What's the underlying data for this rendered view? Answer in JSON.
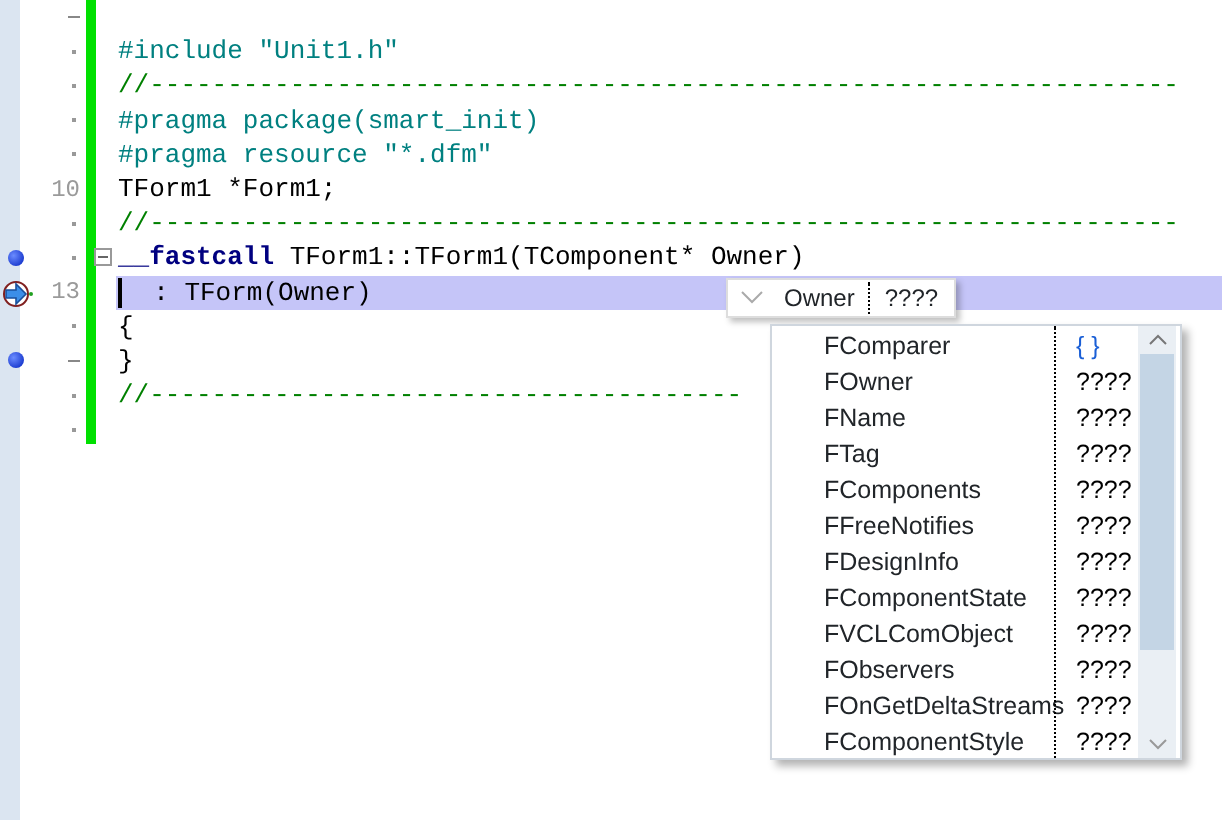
{
  "editor": {
    "lines": [
      {
        "kind": "dash"
      },
      {
        "kind": "dot",
        "segments": [
          {
            "kind": "directive",
            "text": "#include \"Unit1.h\""
          }
        ]
      },
      {
        "kind": "dot",
        "segments": [
          {
            "kind": "comment",
            "text": "//------------------------------------------------------------------"
          }
        ]
      },
      {
        "kind": "dot",
        "segments": [
          {
            "kind": "directive",
            "text": "#pragma package(smart_init)"
          }
        ]
      },
      {
        "kind": "dot",
        "segments": [
          {
            "kind": "directive",
            "text": "#pragma resource \"*.dfm\""
          }
        ]
      },
      {
        "kind": "number",
        "number": "10",
        "segments": [
          {
            "kind": "plain",
            "text": "TForm1 *Form1;"
          }
        ]
      },
      {
        "kind": "dot",
        "segments": [
          {
            "kind": "comment",
            "text": "//------------------------------------------------------------------"
          }
        ]
      },
      {
        "kind": "dot",
        "breakpoint": true,
        "fold": true,
        "segments": [
          {
            "kind": "keyword",
            "text": "__fastcall"
          },
          {
            "kind": "plain",
            "text": " TForm1::TForm1(TComponent* Owner)"
          }
        ]
      },
      {
        "kind": "number",
        "number": "13",
        "exec_point": true,
        "selected": true,
        "segments": [
          {
            "kind": "plain",
            "text": "  : TForm(Owner)"
          }
        ]
      },
      {
        "kind": "dot",
        "segments": [
          {
            "kind": "plain",
            "text": "{"
          }
        ]
      },
      {
        "kind": "dash",
        "breakpoint": true,
        "segments": [
          {
            "kind": "plain",
            "text": "}"
          }
        ]
      },
      {
        "kind": "dot",
        "segments": [
          {
            "kind": "comment",
            "text": "//--------------------------------------"
          }
        ]
      },
      {
        "kind": "dot"
      }
    ]
  },
  "param_hint": {
    "name": "Owner",
    "type": "????"
  },
  "completion": {
    "items": [
      {
        "name": "FComparer",
        "type": "{ }",
        "kind": "set"
      },
      {
        "name": "FOwner",
        "type": "????",
        "kind": "unknown"
      },
      {
        "name": "FName",
        "type": "????",
        "kind": "unknown"
      },
      {
        "name": "FTag",
        "type": "????",
        "kind": "unknown"
      },
      {
        "name": "FComponents",
        "type": "????",
        "kind": "unknown"
      },
      {
        "name": "FFreeNotifies",
        "type": "????",
        "kind": "unknown"
      },
      {
        "name": "FDesignInfo",
        "type": "????",
        "kind": "unknown"
      },
      {
        "name": "FComponentState",
        "type": "????",
        "kind": "unknown"
      },
      {
        "name": "FVCLComObject",
        "type": "????",
        "kind": "unknown"
      },
      {
        "name": "FObservers",
        "type": "????",
        "kind": "unknown"
      },
      {
        "name": "FOnGetDeltaStreams",
        "type": "????",
        "kind": "unknown"
      },
      {
        "name": "FComponentStyle",
        "type": "????",
        "kind": "unknown"
      }
    ]
  }
}
